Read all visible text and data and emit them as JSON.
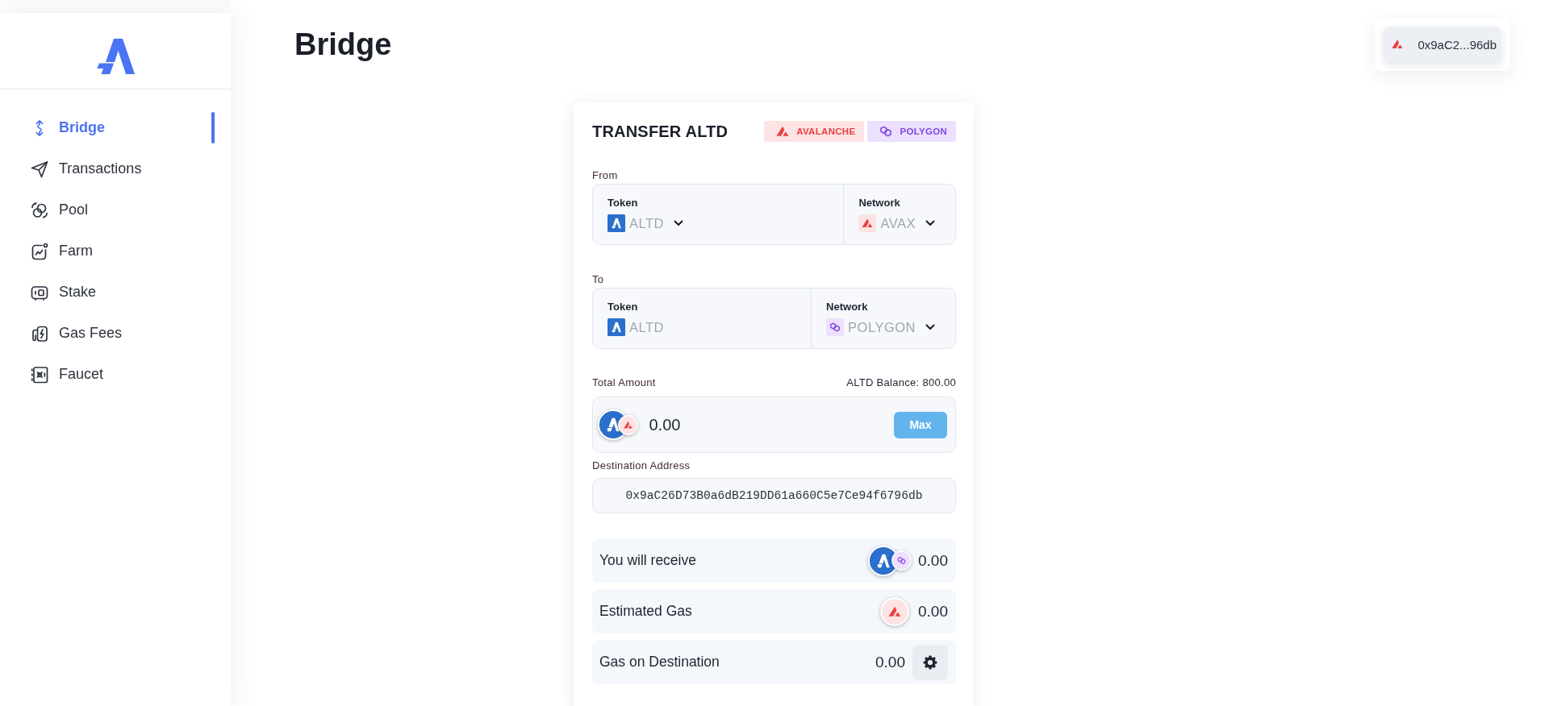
{
  "sidebar": {
    "items": [
      {
        "label": "Bridge",
        "selected": true
      },
      {
        "label": "Transactions",
        "selected": false
      },
      {
        "label": "Pool",
        "selected": false
      },
      {
        "label": "Farm",
        "selected": false
      },
      {
        "label": "Stake",
        "selected": false
      },
      {
        "label": "Gas Fees",
        "selected": false
      },
      {
        "label": "Faucet",
        "selected": false
      }
    ]
  },
  "header": {
    "title": "Bridge",
    "wallet": {
      "address": "0x9aC2...96db"
    }
  },
  "transfer_card": {
    "title": "TRANSFER ALTD",
    "badges": [
      {
        "kind": "avalanche",
        "label": "AVALANCHE"
      },
      {
        "kind": "polygon",
        "label": "POLYGON"
      }
    ],
    "from": {
      "label": "From",
      "token": {
        "label": "Token",
        "value": "ALTD",
        "dropdown": true
      },
      "network": {
        "label": "Network",
        "kind": "avalanche",
        "value": "AVAX",
        "dropdown": true
      }
    },
    "to": {
      "label": "To",
      "token": {
        "label": "Token",
        "value": "ALTD",
        "dropdown": false
      },
      "network": {
        "label": "Network",
        "kind": "polygon",
        "value": "POLYGON",
        "dropdown": true
      }
    },
    "amount": {
      "label": "Total Amount",
      "balance": "ALTD Balance: 800.00",
      "value": "0.00",
      "max_button": "Max"
    },
    "destination": {
      "label": "Destination Address",
      "value": "0x9aC26D73B0a6dB219DD61a660C5e7Ce94f6796db"
    },
    "summary": [
      {
        "kind": "receive",
        "label": "You will receive",
        "value": "0.00"
      },
      {
        "kind": "gas",
        "label": "Estimated Gas",
        "value": "0.00"
      },
      {
        "kind": "setting",
        "label": "Gas on Destination",
        "value": "0.00"
      }
    ]
  }
}
